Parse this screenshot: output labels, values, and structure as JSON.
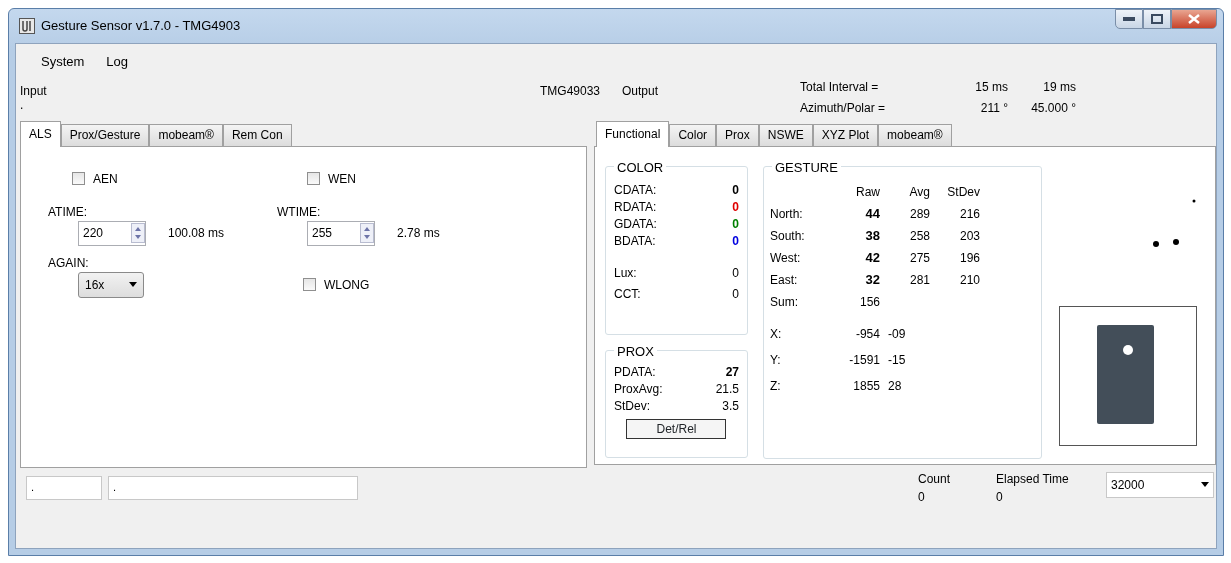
{
  "window": {
    "title": "Gesture Sensor v1.7.0 - TMG4903"
  },
  "menu": [
    {
      "label": "System"
    },
    {
      "label": "Log"
    }
  ],
  "header": {
    "input_label": "Input",
    "input_status": ".",
    "device": "TMG49033",
    "output_label": "Output",
    "readings": [
      {
        "label": "Total Interval =",
        "value_1": "15 ms",
        "value_2": "19 ms"
      },
      {
        "label": "Azimuth/Polar =",
        "value_1": "211 °",
        "value_2": "45.000 °"
      }
    ]
  },
  "left_tabs": [
    {
      "label": "ALS",
      "selected": true
    },
    {
      "label": "Prox/Gesture",
      "selected": false
    },
    {
      "label": "mobeam®",
      "selected": false
    },
    {
      "label": "Rem Con",
      "selected": false
    }
  ],
  "als": {
    "checkboxes": [
      {
        "label": "AEN",
        "checked": false
      },
      {
        "label": "WEN",
        "checked": false
      },
      {
        "label": "WLONG",
        "checked": false
      }
    ],
    "spinners": [
      {
        "label": "ATIME:",
        "value": "220",
        "reading": "100.08 ms"
      },
      {
        "label": "WTIME:",
        "value": "255",
        "reading": "2.78 ms"
      }
    ],
    "gain": {
      "label": "AGAIN:",
      "value": "16x"
    }
  },
  "right_tabs": [
    {
      "label": "Functional",
      "selected": true
    },
    {
      "label": "Color",
      "selected": false
    },
    {
      "label": "Prox",
      "selected": false
    },
    {
      "label": "NSWE",
      "selected": false
    },
    {
      "label": "XYZ Plot",
      "selected": false
    },
    {
      "label": "mobeam®",
      "selected": false
    }
  ],
  "color": {
    "title": "COLOR",
    "rows": [
      {
        "label": "CDATA:",
        "value": "0",
        "bold": true,
        "color": "#000000"
      },
      {
        "label": "RDATA:",
        "value": "0",
        "bold": true,
        "color": "#e00000"
      },
      {
        "label": "GDATA:",
        "value": "0",
        "bold": true,
        "color": "#008000"
      },
      {
        "label": "BDATA:",
        "value": "0",
        "bold": true,
        "color": "#0000e0"
      }
    ],
    "extra": [
      {
        "label": "Lux:",
        "value": "0"
      },
      {
        "label": "CCT:",
        "value": "0"
      }
    ]
  },
  "prox": {
    "title": "PROX",
    "rows": [
      {
        "label": "PDATA:",
        "value": "27",
        "bold": true
      },
      {
        "label": "ProxAvg:",
        "value": "21.5",
        "bold": false
      },
      {
        "label": "StDev:",
        "value": "3.5",
        "bold": false
      }
    ],
    "button": "Det/Rel"
  },
  "gesture": {
    "title": "GESTURE",
    "columns": [
      "Raw",
      "Avg",
      "StDev"
    ],
    "rows": [
      {
        "label": "North:",
        "raw": "44",
        "avg": "289",
        "stdev": "216"
      },
      {
        "label": "South:",
        "raw": "38",
        "avg": "258",
        "stdev": "203"
      },
      {
        "label": "West:",
        "raw": "42",
        "avg": "275",
        "stdev": "196"
      },
      {
        "label": "East:",
        "raw": "32",
        "avg": "281",
        "stdev": "210"
      }
    ],
    "sum": {
      "label": "Sum:",
      "raw": "156"
    },
    "axes": [
      {
        "label": "X:",
        "value": "-954",
        "delta": "-09"
      },
      {
        "label": "Y:",
        "value": "-1591",
        "delta": "-15"
      },
      {
        "label": "Z:",
        "value": "1855",
        "delta": "28"
      }
    ]
  },
  "footer": {
    "fields": [
      {
        "value": "."
      },
      {
        "value": "."
      }
    ],
    "counters": [
      {
        "label": "Count",
        "value": "0"
      },
      {
        "label": "Elapsed Time",
        "value": "0"
      }
    ],
    "rate": {
      "value": "32000"
    }
  }
}
